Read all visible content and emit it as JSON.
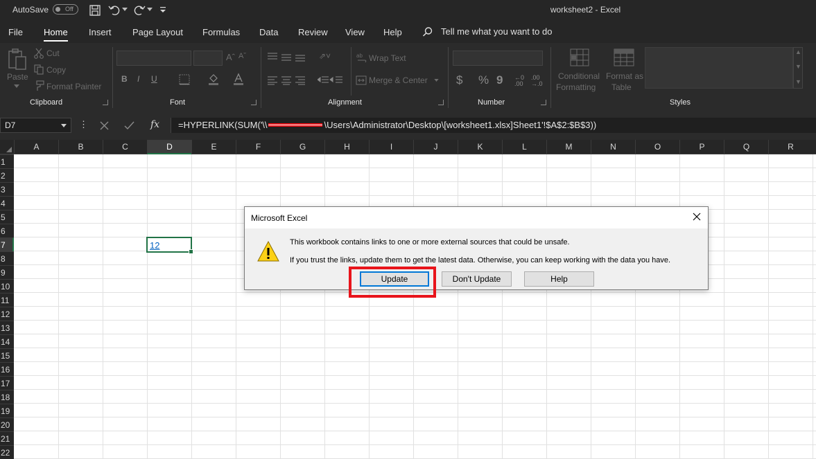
{
  "titlebar": {
    "autosave_label": "AutoSave",
    "autosave_state": "Off",
    "window_title": "worksheet2  -  Excel"
  },
  "menu": {
    "tabs": [
      "File",
      "Home",
      "Insert",
      "Page Layout",
      "Formulas",
      "Data",
      "Review",
      "View",
      "Help"
    ],
    "active_tab": "Home",
    "tell_me": "Tell me what you want to do"
  },
  "ribbon": {
    "clipboard": {
      "label": "Clipboard",
      "paste": "Paste",
      "cut": "Cut",
      "copy": "Copy",
      "format_painter": "Format Painter"
    },
    "font": {
      "label": "Font"
    },
    "alignment": {
      "label": "Alignment",
      "wrap_text": "Wrap Text",
      "merge_center": "Merge & Center"
    },
    "number": {
      "label": "Number"
    },
    "styles": {
      "label": "Styles",
      "conditional_formatting_1": "Conditional",
      "conditional_formatting_2": "Formatting",
      "format_as_table_1": "Format as",
      "format_as_table_2": "Table"
    }
  },
  "formula_bar": {
    "name_box": "D7",
    "fx": "fx",
    "formula_prefix": "=HYPERLINK(SUM('\\\\",
    "formula_suffix": "\\Users\\Administrator\\Desktop\\[worksheet1.xlsx]Sheet1'!$A$2:$B$3))"
  },
  "grid": {
    "columns": [
      "A",
      "B",
      "C",
      "D",
      "E",
      "F",
      "G",
      "H",
      "I",
      "J",
      "K",
      "L",
      "M",
      "N",
      "O",
      "P",
      "Q",
      "R"
    ],
    "selected_column": "D",
    "rows": [
      "1",
      "2",
      "3",
      "4",
      "5",
      "6",
      "7",
      "8",
      "9",
      "10",
      "11",
      "12",
      "13",
      "14",
      "15",
      "16",
      "17",
      "18",
      "19",
      "20",
      "21",
      "22"
    ],
    "selected_row": "7",
    "active_cell_value": "12"
  },
  "dialog": {
    "title": "Microsoft Excel",
    "message_1": "This workbook contains links to one or more external sources that could be unsafe.",
    "message_2": "If you trust the links, update them to get the latest data. Otherwise, you can keep working with the data you have.",
    "buttons": {
      "update": "Update",
      "dont_update": "Don't Update",
      "help": "Help"
    }
  },
  "colors": {
    "chrome_dark": "#262626",
    "ribbon": "#2b2b2b",
    "excel_green": "#217346",
    "highlight_red": "#e8141b",
    "hyperlink": "#0563c1"
  }
}
